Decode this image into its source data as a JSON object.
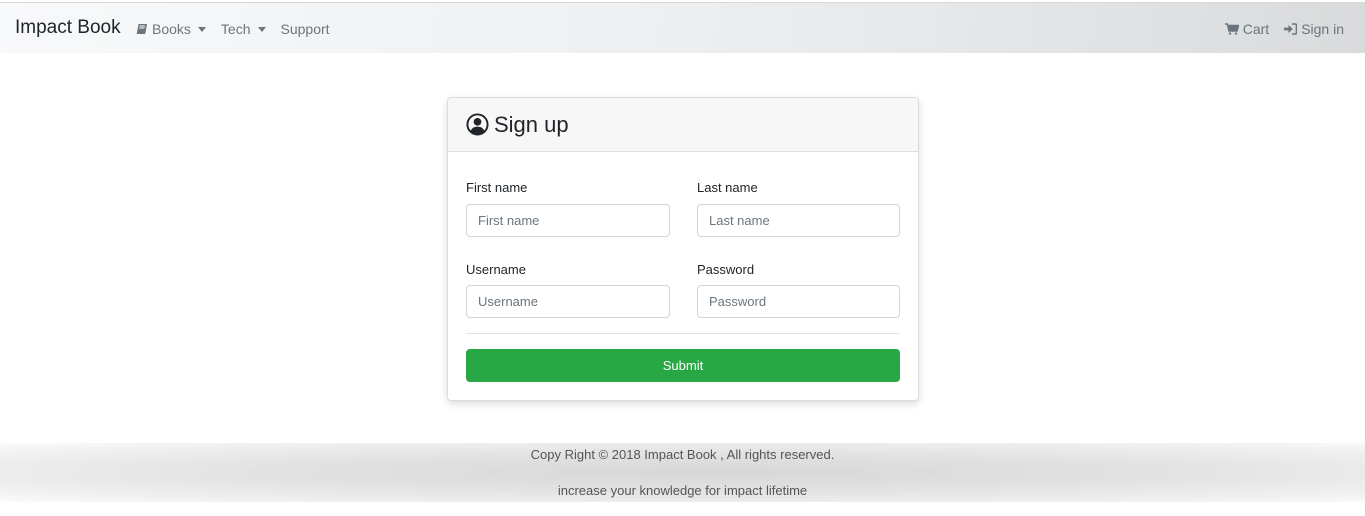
{
  "navbar": {
    "brand": "Impact Book",
    "links": {
      "books": "Books",
      "tech": "Tech",
      "support": "Support",
      "cart": "Cart",
      "signin": "Sign in"
    }
  },
  "signup": {
    "title": "Sign up",
    "first_name": {
      "label": "First name",
      "placeholder": "First name",
      "value": ""
    },
    "last_name": {
      "label": "Last name",
      "placeholder": "Last name",
      "value": ""
    },
    "username": {
      "label": "Username",
      "placeholder": "Username",
      "value": ""
    },
    "password": {
      "label": "Password",
      "placeholder": "Password",
      "value": ""
    },
    "submit_label": "Submit"
  },
  "footer": {
    "copyright": "Copy Right © 2018 Impact Book , All rights reserved.",
    "tagline": "increase your knowledge for impact lifetime"
  },
  "colors": {
    "accent_submit": "#28a745",
    "nav_link": "#6c757d"
  },
  "icons": {
    "books": "book-icon",
    "cart": "cart-icon",
    "signin": "sign-in-icon",
    "signup": "user-circle-icon"
  }
}
